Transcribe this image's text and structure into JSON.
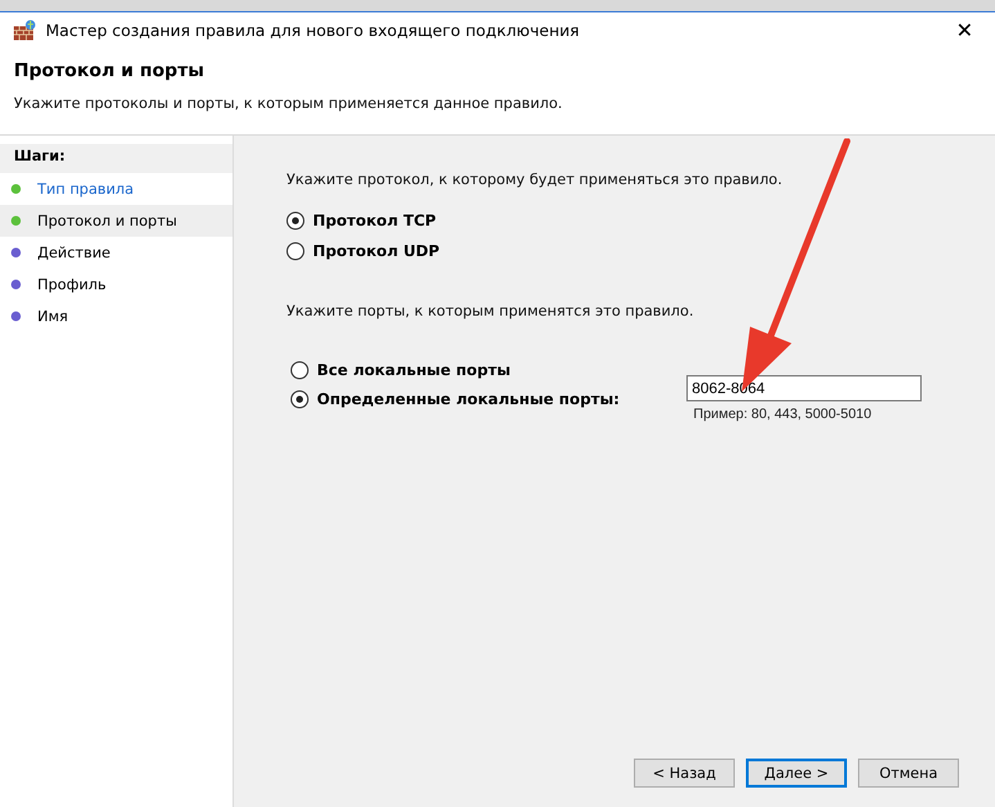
{
  "window": {
    "title": "Мастер создания правила для нового входящего подключения",
    "close": "✕"
  },
  "header": {
    "title": "Протокол и порты",
    "subtitle": "Укажите протоколы и порты, к которым применяется данное правило."
  },
  "steps": {
    "heading": "Шаги:",
    "items": [
      {
        "label": "Тип правила",
        "color": "#5cc13c",
        "done": true,
        "selected": false
      },
      {
        "label": "Протокол и порты",
        "color": "#5cc13c",
        "done": true,
        "selected": true
      },
      {
        "label": "Действие",
        "color": "#6a5ed0",
        "done": false,
        "selected": false
      },
      {
        "label": "Профиль",
        "color": "#6a5ed0",
        "done": false,
        "selected": false
      },
      {
        "label": "Имя",
        "color": "#6a5ed0",
        "done": false,
        "selected": false
      }
    ]
  },
  "protocol": {
    "prompt": "Укажите протокол, к которому будет применяться это правило.",
    "options": [
      {
        "label": "Протокол TCP",
        "selected": true
      },
      {
        "label": "Протокол UDP",
        "selected": false
      }
    ]
  },
  "ports": {
    "prompt": "Укажите порты, к которым применятся это правило.",
    "options": [
      {
        "label": "Все локальные порты",
        "selected": false
      },
      {
        "label": "Определенные локальные порты:",
        "selected": true
      }
    ],
    "value": "8062-8064",
    "example": "Пример: 80, 443, 5000-5010"
  },
  "buttons": [
    {
      "label": "< Назад",
      "default": false
    },
    {
      "label": "Далее >",
      "default": true
    },
    {
      "label": "Отмена",
      "default": false
    }
  ]
}
